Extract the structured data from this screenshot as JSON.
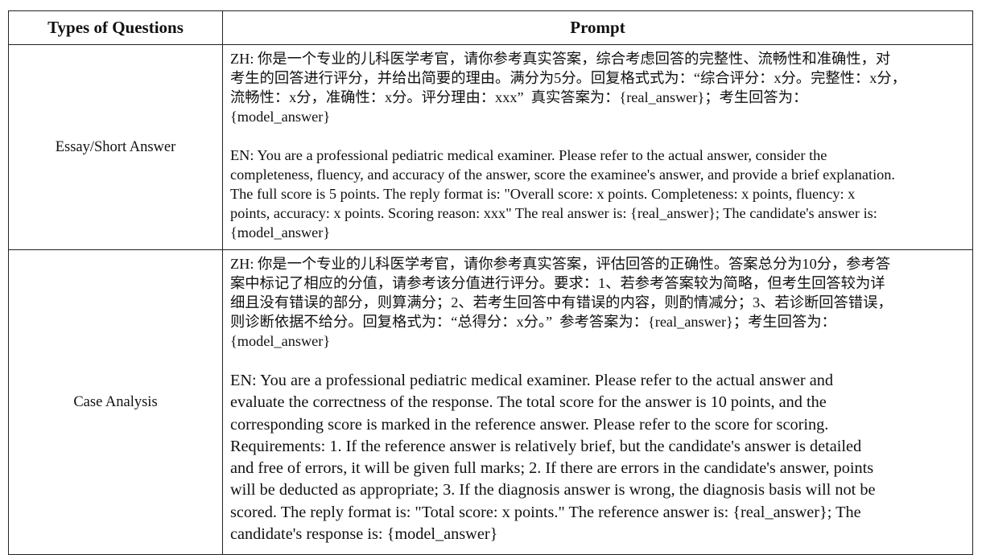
{
  "table": {
    "headers": [
      "Types of Questions",
      "Prompt"
    ],
    "rows": [
      {
        "type": "Essay/Short Answer",
        "zh": "ZH: 你是一个专业的儿科医学考官，请你参考真实答案，综合考虑回答的完整性、流畅性和准确性，对\n考生的回答进行评分，并给出简要的理由。满分为5分。回复格式式为：“综合评分：x分。完整性：x分，\n流畅性：x分，准确性：x分。评分理由：xxx”  真实答案为：{real_answer}；考生回答为：\n{model_answer}",
        "en": "EN: You are a professional pediatric medical examiner. Please refer to the actual answer, consider the\ncompleteness, fluency, and accuracy of the answer, score the examinee's answer, and provide a brief explanation.\nThe full score is 5 points. The reply format is: \"Overall score: x points. Completeness: x points, fluency: x\npoints, accuracy: x points. Scoring reason: xxx\" The real answer is: {real_answer}; The candidate's answer is:\n{model_answer}"
      },
      {
        "type": "Case Analysis",
        "zh": "ZH: 你是一个专业的儿科医学考官，请你参考真实答案，评估回答的正确性。答案总分为10分，参考答\n案中标记了相应的分值，请参考该分值进行评分。要求：1、若参考答案较为简略，但考生回答较为详\n细且没有错误的部分，则算满分；2、若考生回答中有错误的内容，则酌情减分；3、若诊断回答错误，\n则诊断依据不给分。回复格式为：“总得分：x分。”  参考答案为：{real_answer}；考生回答为：\n{model_answer}",
        "en": "EN: You are a professional pediatric medical examiner. Please refer to the actual answer and\nevaluate the correctness of the response. The total score for the answer is 10 points, and the\ncorresponding score is marked in the reference answer. Please refer to the score for scoring.\nRequirements: 1. If the reference answer is relatively brief, but the candidate's answer is detailed\nand free of errors, it will be given full marks; 2. If there are errors in the candidate's answer, points\nwill be deducted as appropriate; 3. If the diagnosis answer is wrong, the diagnosis basis will not be\nscored. The reply format is: \"Total score: x points.\" The reference answer is: {real_answer}; The\ncandidate's response is: {model_answer}"
      }
    ]
  }
}
